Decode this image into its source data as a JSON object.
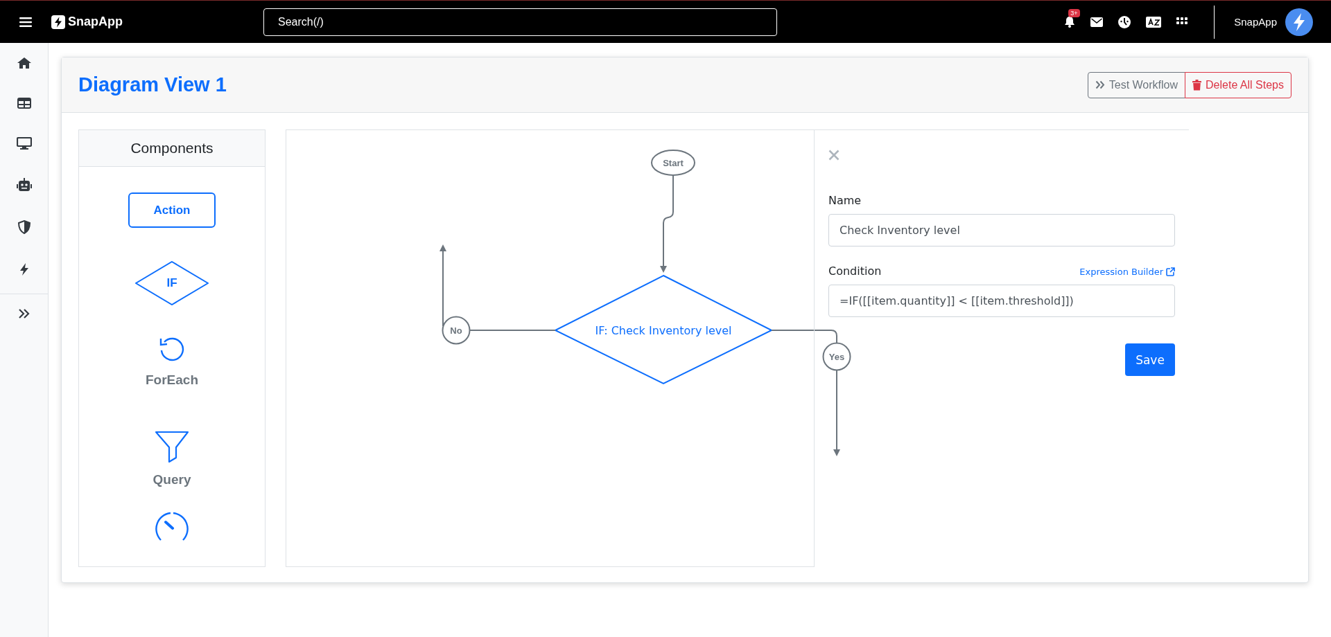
{
  "topbar": {
    "brand": "SnapApp",
    "search": {
      "placeholder": "Search(/)"
    },
    "notification_badge": "3+",
    "user_name": "SnapApp"
  },
  "page": {
    "title": "Diagram View 1",
    "buttons": [
      {
        "label": "Test Workflow",
        "kind": "outline"
      },
      {
        "label": "Delete All Steps",
        "kind": "danger"
      }
    ]
  },
  "components": {
    "title": "Components",
    "items": [
      {
        "kind": "action",
        "label": "Action"
      },
      {
        "kind": "if",
        "label": "IF"
      },
      {
        "kind": "foreach",
        "label": "ForEach"
      },
      {
        "kind": "query",
        "label": "Query"
      },
      {
        "kind": "timer"
      }
    ]
  },
  "diagram": {
    "start": "Start",
    "condition": "IF: Check Inventory level",
    "no": "No",
    "yes": "Yes"
  },
  "editor": {
    "name_label": "Name",
    "name_value": "Check Inventory level",
    "condition_label": "Condition",
    "expression_link": "Expression Builder",
    "condition_value": "=IF([[item.quantity]] < [[item.threshold]])",
    "save": "Save"
  }
}
